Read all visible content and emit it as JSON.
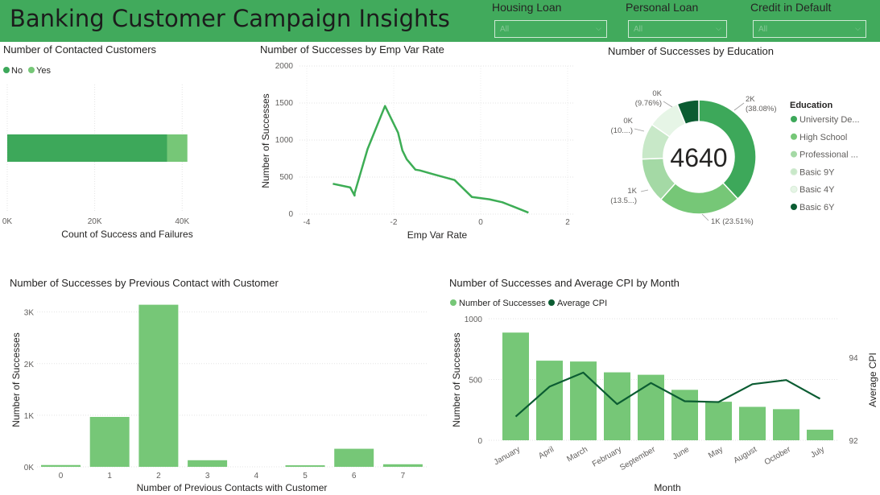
{
  "header": {
    "title": "Banking Customer Campaign Insights",
    "slicers": [
      {
        "label": "Housing Loan",
        "value": "All"
      },
      {
        "label": "Personal Loan",
        "value": "All"
      },
      {
        "label": "Credit in Default",
        "value": "All"
      }
    ]
  },
  "colors": {
    "header_bg": "#41aa5c",
    "green": "#3da85a",
    "light_green": "#76c777",
    "dark_green": "#0b5c32",
    "line_green": "#3dad55"
  },
  "chart_data": [
    {
      "id": "contacted",
      "type": "bar",
      "orientation": "horizontal",
      "stacked": true,
      "title": "Number of Contacted Customers",
      "xlabel": "Count of Success and Failures",
      "ylabel": "",
      "legend_position": "top-left",
      "xlim": [
        0,
        44000
      ],
      "xticks": [
        "0K",
        "20K",
        "40K"
      ],
      "series": [
        {
          "name": "No",
          "values": [
            36548
          ],
          "color": "#3da85a"
        },
        {
          "name": "Yes",
          "values": [
            4640
          ],
          "color": "#76c777"
        }
      ]
    },
    {
      "id": "emp_var",
      "type": "line",
      "title": "Number of Successes by Emp Var Rate",
      "xlabel": "Emp Var Rate",
      "ylabel": "Number of Successes",
      "xlim": [
        -4,
        2
      ],
      "ylim": [
        0,
        2000
      ],
      "xticks": [
        "-4",
        "-2",
        "0",
        "2"
      ],
      "yticks": [
        "0",
        "500",
        "1000",
        "1500",
        "2000"
      ],
      "x": [
        -3.4,
        -3.0,
        -2.9,
        -2.9,
        -2.6,
        -2.2,
        -1.9,
        -1.8,
        -1.7,
        -1.5,
        -1.4,
        -1.1,
        -0.6,
        -0.2,
        0.2,
        0.5,
        0.8,
        1.1
      ],
      "y": [
        410,
        360,
        250,
        280,
        880,
        1460,
        1100,
        860,
        740,
        600,
        590,
        540,
        460,
        230,
        200,
        160,
        90,
        20
      ]
    },
    {
      "id": "education",
      "type": "pie",
      "donut": true,
      "title": "Number of Successes by Education",
      "center_label": "4640",
      "legend_title": "Education",
      "legend_position": "right",
      "labels": [
        "University De...",
        "High School",
        "Professional ...",
        "Basic 9Y",
        "Basic 4Y",
        "Basic 6Y"
      ],
      "values": [
        1767,
        1091,
        595,
        473,
        428,
        286
      ],
      "colors": [
        "#3da85a",
        "#76c777",
        "#a4d9a5",
        "#c8e8c8",
        "#e6f5e6",
        "#0b5c32"
      ],
      "slice_labels": [
        "2K\n(38.08%)",
        "1K (23.51%)",
        "1K\n(13.5...)",
        "0K\n(10....)",
        "0K\n(9.76%)",
        ""
      ]
    },
    {
      "id": "previous",
      "type": "bar",
      "title": "Number of Successes by Previous Contact with Customer",
      "xlabel": "Number of Previous Contacts with Customer",
      "ylabel": "Number of Successes",
      "ylim": [
        0,
        3400
      ],
      "yticks": [
        "0K",
        "1K",
        "2K",
        "3K"
      ],
      "categories": [
        "0",
        "1",
        "2",
        "3",
        "4",
        "5",
        "6",
        "7"
      ],
      "values": [
        35,
        967,
        3141,
        128,
        0,
        30,
        350,
        50
      ]
    },
    {
      "id": "month",
      "type": "bar",
      "combo": "bar-line",
      "title": "Number of Successes and Average CPI by Month",
      "xlabel": "Month",
      "ylabel": "Number of Successes",
      "y2label": "Average CPI",
      "legend_position": "top-left",
      "ylim": [
        0,
        1000
      ],
      "y2lim": [
        92,
        94.5
      ],
      "yticks": [
        "0",
        "500",
        "1000"
      ],
      "y2ticks": [
        "92",
        "94"
      ],
      "categories": [
        "January",
        "April",
        "March",
        "February",
        "September",
        "June",
        "May",
        "August",
        "October",
        "July"
      ],
      "series": [
        {
          "name": "Number of Successes",
          "values": [
            886,
            655,
            648,
            559,
            539,
            415,
            317,
            275,
            256,
            87
          ],
          "color": "#76c777"
        },
        {
          "name": "Average CPI",
          "values": [
            92.57,
            93.29,
            93.63,
            92.87,
            93.38,
            92.94,
            92.92,
            93.35,
            93.45,
            93.0
          ],
          "color": "#0b5c32"
        }
      ]
    }
  ]
}
